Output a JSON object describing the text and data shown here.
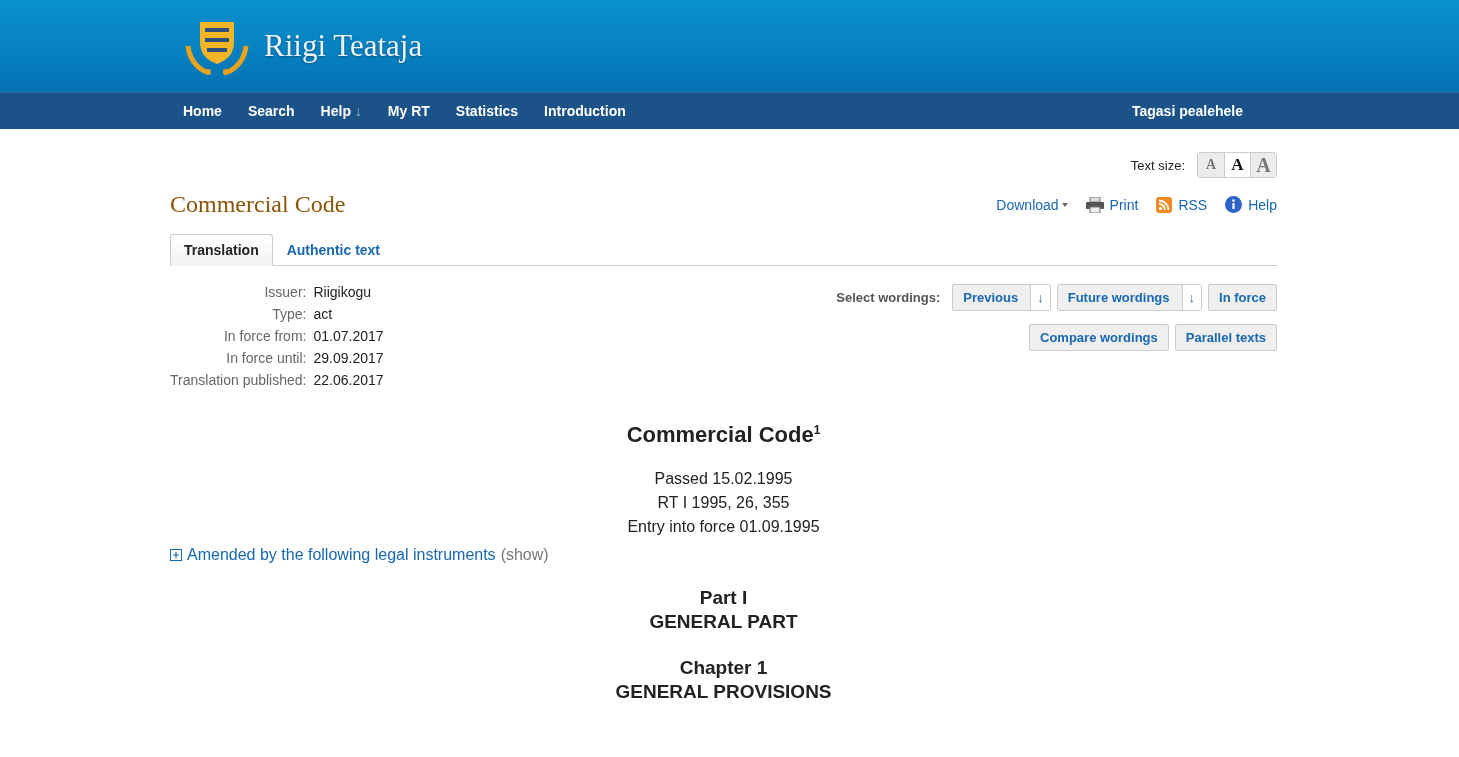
{
  "site": {
    "title": "Riigi Teataja"
  },
  "nav": {
    "items": [
      {
        "label": "Home"
      },
      {
        "label": "Search"
      },
      {
        "label": "Help",
        "arrow": "↓"
      },
      {
        "label": "My RT"
      },
      {
        "label": "Statistics"
      },
      {
        "label": "Introduction"
      }
    ],
    "back_link": "Tagasi pealehele"
  },
  "text_size": {
    "label": "Text size:",
    "options": [
      {
        "label": "A",
        "selected": false
      },
      {
        "label": "A",
        "selected": true
      },
      {
        "label": "A",
        "selected": false
      }
    ]
  },
  "document_title": "Commercial Code",
  "actions": [
    {
      "kind": "download",
      "label": "Download"
    },
    {
      "kind": "print",
      "label": "Print"
    },
    {
      "kind": "rss",
      "label": "RSS"
    },
    {
      "kind": "help",
      "label": "Help"
    }
  ],
  "tabs": [
    {
      "label": "Translation",
      "selected": true
    },
    {
      "label": "Authentic text",
      "selected": false
    }
  ],
  "metadata": [
    {
      "label": "Issuer:",
      "value": "Riigikogu"
    },
    {
      "label": "Type:",
      "value": "act"
    },
    {
      "label": "In force from:",
      "value": "01.07.2017"
    },
    {
      "label": "In force until:",
      "value": "29.09.2017"
    },
    {
      "label": "Translation published:",
      "value": "22.06.2017"
    }
  ],
  "wordings": {
    "label": "Select wordings:",
    "buttons": [
      {
        "label": "Previous",
        "arrow": "↓"
      },
      {
        "label": "Future wordings",
        "arrow": "↓"
      },
      {
        "label": "In force"
      }
    ],
    "buttons_row2": [
      {
        "label": "Compare wordings"
      },
      {
        "label": "Parallel texts"
      }
    ]
  },
  "act": {
    "title": "Commercial Code$^{1}$",
    "lines": [
      "Passed 15.02.1995",
      "RT I 1995, 26, 355",
      "Entry into force 01.09.1995"
    ],
    "amended": {
      "link": "Amended by the following legal instruments",
      "toggle": "(show)",
      "expanded": false
    },
    "headings": [
      {
        "lines": [
          "Part I",
          "GENERAL PART"
        ]
      },
      {
        "lines": [
          "Chapter 1",
          "GENERAL PROVISIONS"
        ]
      }
    ]
  }
}
